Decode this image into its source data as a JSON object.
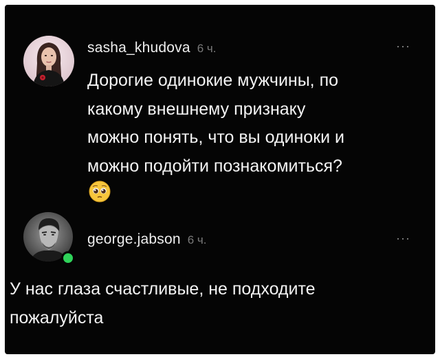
{
  "comments": [
    {
      "username": "sasha_khudova",
      "time": "6 ч.",
      "text": "Дорогие одинокие мужчины, по\nкакому внешнему признаку\nможно понять, что вы одиноки и\nможно подойти познакомиться?",
      "emoji": "pleading-face-emoji",
      "avatar": "woman-portrait-avatar"
    },
    {
      "username": "george.jabson",
      "time": "6 ч.",
      "text": "У нас глаза счастливые, не подходите\nпожалуйста",
      "avatar": "man-portrait-avatar",
      "online": true
    }
  ],
  "more_label": "···",
  "colors": {
    "background": "#050505",
    "text": "#f3f3f3",
    "muted": "#7a7a7a",
    "online": "#2fd35a"
  }
}
